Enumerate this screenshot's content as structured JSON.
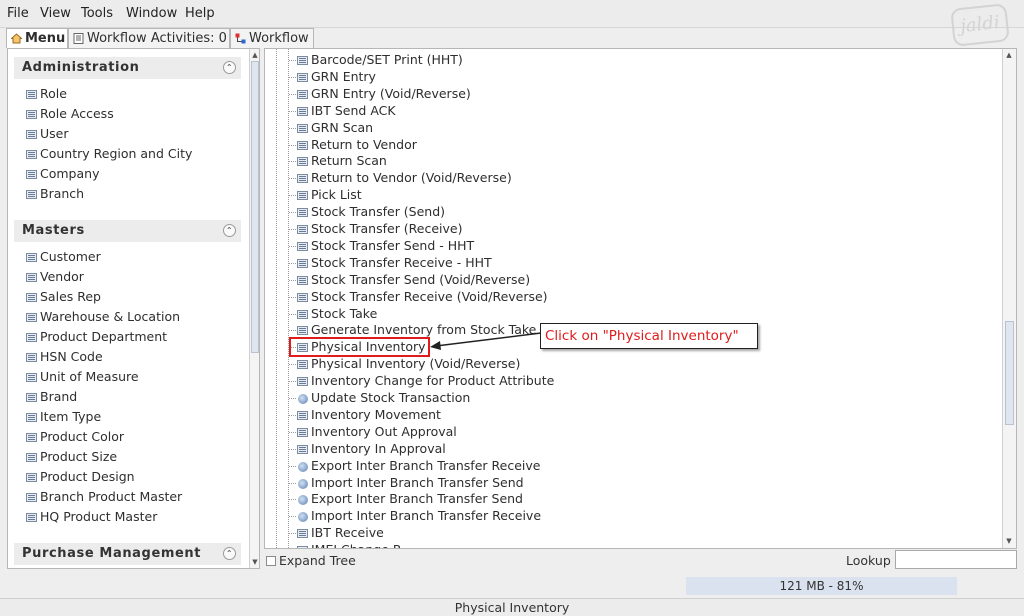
{
  "menubar": {
    "file": "File",
    "view": "View",
    "tools": "Tools",
    "window": "Window",
    "help": "Help"
  },
  "logo_text": "jaldi",
  "tabs": {
    "menu": "Menu",
    "workflow_activities": "Workflow Activities: 0",
    "workflow": "Workflow"
  },
  "sections": [
    {
      "title": "Administration",
      "items": [
        "Role",
        "Role Access",
        "User",
        "Country Region and City",
        "Company",
        "Branch"
      ]
    },
    {
      "title": "Masters",
      "items": [
        "Customer",
        "Vendor",
        "Sales Rep",
        "Warehouse & Location",
        "Product Department",
        "HSN Code",
        "Unit of Measure",
        "Brand",
        "Item Type",
        "Product Color",
        "Product Size",
        "Product Design",
        "Branch Product Master",
        "HQ Product Master"
      ]
    },
    {
      "title": "Purchase Management",
      "items": []
    }
  ],
  "tree_items": [
    {
      "label": "Barcode/SET Print (HHT)",
      "icon": "form-icon"
    },
    {
      "label": "GRN Entry",
      "icon": "form-icon"
    },
    {
      "label": "GRN Entry (Void/Reverse)",
      "icon": "form-icon"
    },
    {
      "label": "IBT Send ACK",
      "icon": "form-icon"
    },
    {
      "label": "GRN Scan",
      "icon": "form-icon"
    },
    {
      "label": "Return to Vendor",
      "icon": "form-icon"
    },
    {
      "label": "Return Scan",
      "icon": "form-icon"
    },
    {
      "label": "Return to Vendor (Void/Reverse)",
      "icon": "form-icon"
    },
    {
      "label": "Pick List",
      "icon": "form-icon"
    },
    {
      "label": "Stock Transfer (Send)",
      "icon": "form-icon"
    },
    {
      "label": "Stock Transfer (Receive)",
      "icon": "form-icon"
    },
    {
      "label": "Stock Transfer Send - HHT",
      "icon": "form-icon"
    },
    {
      "label": "Stock Transfer Receive - HHT",
      "icon": "form-icon"
    },
    {
      "label": "Stock Transfer Send (Void/Reverse)",
      "icon": "form-icon"
    },
    {
      "label": "Stock Transfer Receive (Void/Reverse)",
      "icon": "form-icon"
    },
    {
      "label": "Stock Take",
      "icon": "form-icon"
    },
    {
      "label": "Generate Inventory from Stock Take",
      "icon": "form-icon"
    },
    {
      "label": "Physical Inventory",
      "icon": "form-icon"
    },
    {
      "label": "Physical Inventory (Void/Reverse)",
      "icon": "form-icon"
    },
    {
      "label": "Inventory Change for Product Attribute",
      "icon": "form-icon"
    },
    {
      "label": "Update Stock Transaction",
      "icon": "process-icon"
    },
    {
      "label": "Inventory Movement",
      "icon": "form-icon"
    },
    {
      "label": "Inventory Out Approval",
      "icon": "form-icon"
    },
    {
      "label": "Inventory In Approval",
      "icon": "form-icon"
    },
    {
      "label": "Export Inter Branch Transfer Receive",
      "icon": "process-icon"
    },
    {
      "label": "Import Inter Branch Transfer Send",
      "icon": "process-icon"
    },
    {
      "label": "Export Inter Branch Transfer Send",
      "icon": "process-icon"
    },
    {
      "label": "Import Inter Branch Transfer Receive",
      "icon": "process-icon"
    },
    {
      "label": "IBT Receive",
      "icon": "form-icon"
    },
    {
      "label": "IMEI Change R...",
      "icon": "form-icon"
    }
  ],
  "annotation": {
    "callout_text": "Click on \"Physical Inventory\"",
    "highlight_color": "#e01b1b"
  },
  "bottom": {
    "expand_tree": "Expand Tree",
    "lookup_label": "Lookup",
    "lookup_value": ""
  },
  "memory": "121 MB - 81%",
  "status": "Physical Inventory"
}
